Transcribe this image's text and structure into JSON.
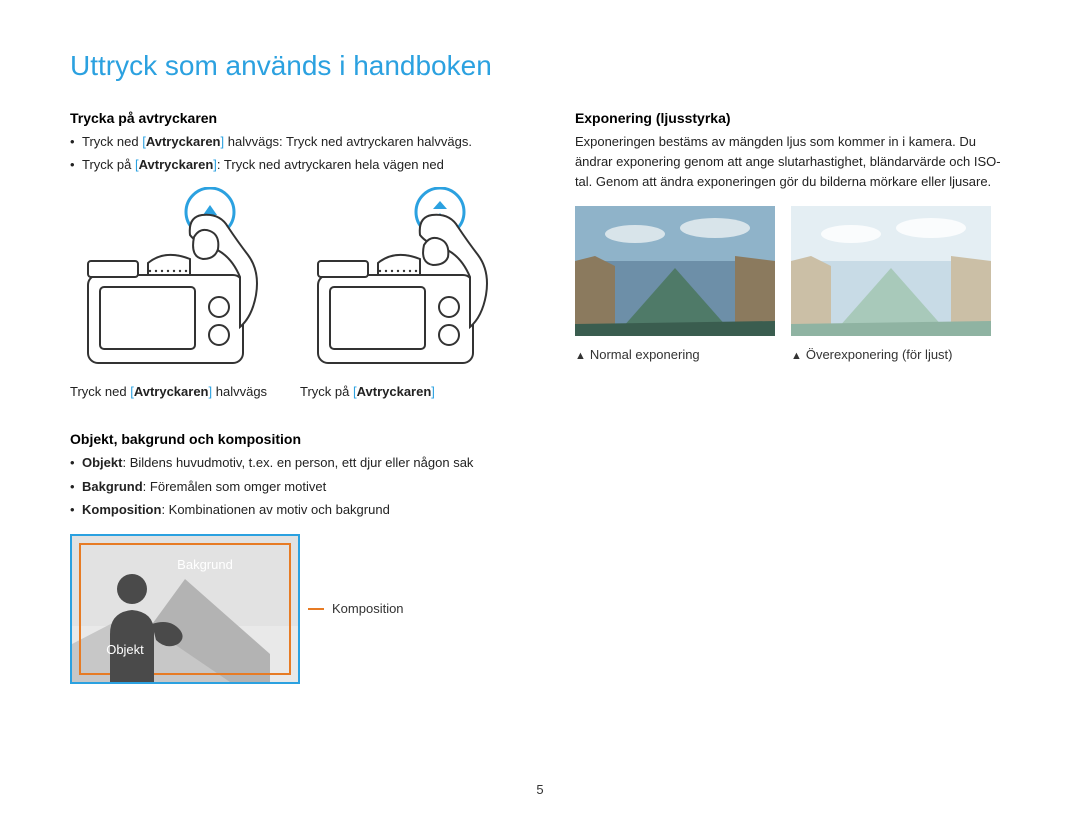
{
  "page_title": "Uttryck som används i handboken",
  "page_number": "5",
  "left": {
    "shutter": {
      "heading": "Trycka på avtryckaren",
      "bullet1": {
        "pre": "Tryck ned ",
        "lb": "[",
        "bold": "Avtryckaren",
        "rb": "]",
        "post": " halvvägs: Tryck ned avtryckaren halvvägs."
      },
      "bullet2": {
        "pre": "Tryck på ",
        "lb": "[",
        "bold": "Avtryckaren",
        "rb": "]",
        "post": ": Tryck ned avtryckaren hela vägen ned"
      },
      "cap1": {
        "pre": "Tryck ned ",
        "lb": "[",
        "bold": "Avtryckaren",
        "rb": "]",
        "post": " halvvägs"
      },
      "cap2": {
        "pre": "Tryck på ",
        "lb": "[",
        "bold": "Avtryckaren",
        "rb": "]",
        "post": ""
      }
    },
    "composition": {
      "heading": "Objekt, bakgrund och komposition",
      "b1": {
        "bold": "Objekt",
        "text": ": Bildens huvudmotiv, t.ex. en person, ett djur eller någon sak"
      },
      "b2": {
        "bold": "Bakgrund",
        "text": ": Föremålen som omger motivet"
      },
      "b3": {
        "bold": "Komposition",
        "text": ": Kombinationen av motiv och bakgrund"
      },
      "label_bakgrund": "Bakgrund",
      "label_objekt": "Objekt",
      "label_komposition": "Komposition"
    }
  },
  "right": {
    "exposure": {
      "heading": "Exponering (ljusstyrka)",
      "para": "Exponeringen bestäms av mängden ljus som kommer in i kamera. Du ändrar exponering genom att ange slutarhastighet, bländarvärde och ISO-tal. Genom att ändra exponeringen gör du bilderna mörkare eller ljusare.",
      "cap_normal": "Normal exponering",
      "cap_over": "Överexponering (för ljust)"
    }
  }
}
